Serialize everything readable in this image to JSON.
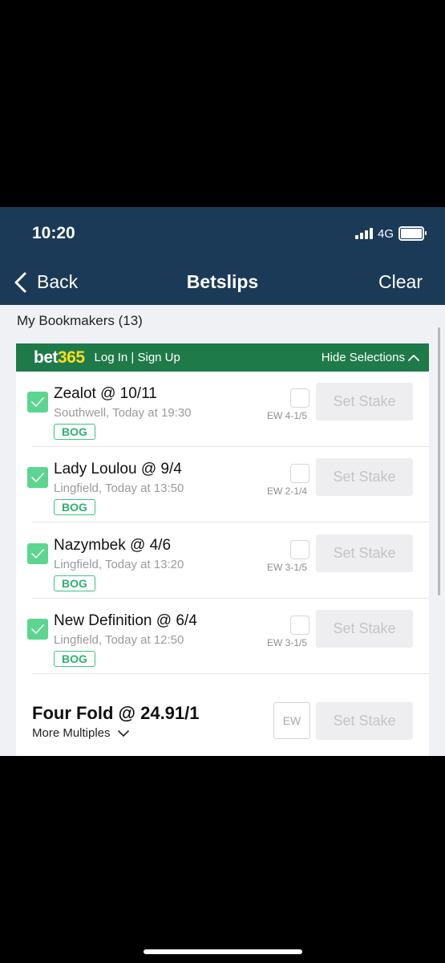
{
  "status_bar": {
    "time": "10:20",
    "network": "4G"
  },
  "nav": {
    "back_label": "Back",
    "title": "Betslips",
    "clear_label": "Clear"
  },
  "section": {
    "heading": "My Bookmakers (13)"
  },
  "bookmaker": {
    "logo_a": "bet",
    "logo_b": "365",
    "login_label": "Log In | Sign Up",
    "hide_label": "Hide Selections",
    "brand_color": "#1f7a4a"
  },
  "selections": [
    {
      "name": "Zealot @ 10/11",
      "venue": "Southwell, Today at 19:30",
      "badge": "BOG",
      "ew_terms": "EW 4-1/5",
      "stake_label": "Set Stake"
    },
    {
      "name": "Lady Loulou @ 9/4",
      "venue": "Lingfield, Today at 13:50",
      "badge": "BOG",
      "ew_terms": "EW 2-1/4",
      "stake_label": "Set Stake"
    },
    {
      "name": "Nazymbek @ 4/6",
      "venue": "Lingfield, Today at 13:20",
      "badge": "BOG",
      "ew_terms": "EW 3-1/5",
      "stake_label": "Set Stake"
    },
    {
      "name": "New Definition @ 6/4",
      "venue": "Lingfield, Today at 12:50",
      "badge": "BOG",
      "ew_terms": "EW 3-1/5",
      "stake_label": "Set Stake"
    }
  ],
  "multiple": {
    "title": "Four Fold @ 24.91/1",
    "more_label": "More Multiples",
    "ew_label": "EW",
    "stake_label": "Set Stake"
  }
}
